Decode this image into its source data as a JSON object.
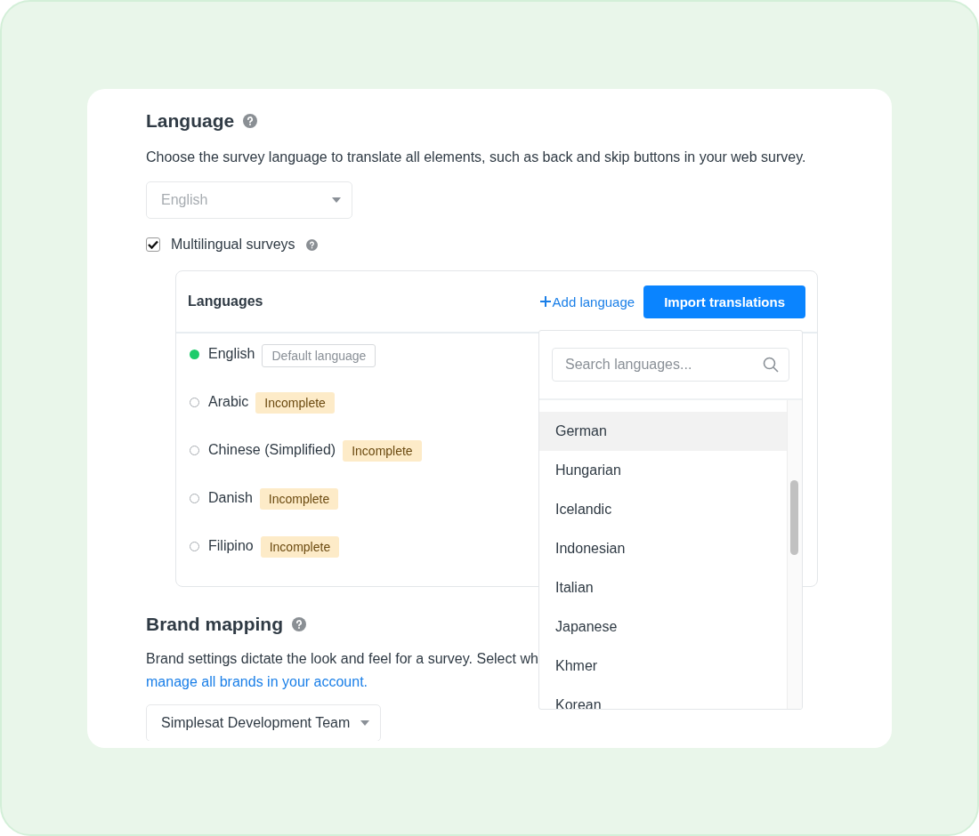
{
  "language_section": {
    "title": "Language",
    "description": "Choose the survey language to translate all elements, such as back and skip buttons in your web survey.",
    "select": {
      "value": "English",
      "disabled": true
    },
    "multilingual": {
      "label": "Multilingual surveys",
      "checked": true
    }
  },
  "languages_panel": {
    "title": "Languages",
    "add_link": "Add language",
    "import_button": "Import translations",
    "rows": [
      {
        "name": "English",
        "active": true,
        "badge": {
          "kind": "default",
          "label": "Default language"
        }
      },
      {
        "name": "Arabic",
        "active": false,
        "badge": {
          "kind": "incomplete",
          "label": "Incomplete"
        }
      },
      {
        "name": "Chinese (Simplified)",
        "active": false,
        "badge": {
          "kind": "incomplete",
          "label": "Incomplete"
        }
      },
      {
        "name": "Danish",
        "active": false,
        "badge": {
          "kind": "incomplete",
          "label": "Incomplete"
        }
      },
      {
        "name": "Filipino",
        "active": false,
        "badge": {
          "kind": "incomplete",
          "label": "Incomplete"
        }
      }
    ]
  },
  "language_dropdown": {
    "search_placeholder": "Search languages...",
    "options": [
      {
        "label": "German",
        "selected": true
      },
      {
        "label": "Hungarian",
        "selected": false
      },
      {
        "label": "Icelandic",
        "selected": false
      },
      {
        "label": "Indonesian",
        "selected": false
      },
      {
        "label": "Italian",
        "selected": false
      },
      {
        "label": "Japanese",
        "selected": false
      },
      {
        "label": "Khmer",
        "selected": false
      },
      {
        "label": "Korean",
        "selected": false
      }
    ]
  },
  "brand_section": {
    "title": "Brand mapping",
    "description": "Brand settings dictate the look and feel for a survey. Select wh",
    "link": "manage all brands in your account.",
    "select": {
      "value": "Simplesat Development Team"
    }
  }
}
